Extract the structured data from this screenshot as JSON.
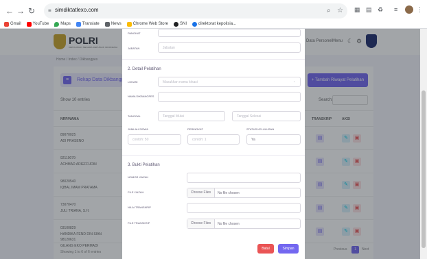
{
  "browser": {
    "url": "simdiktatlexo.com",
    "bookmarks": [
      {
        "label": "Gmail",
        "color": "#ea4335"
      },
      {
        "label": "YouTube",
        "color": "#ff0000"
      },
      {
        "label": "Maps",
        "color": "#34a853"
      },
      {
        "label": "Translate",
        "color": "#4285f4"
      },
      {
        "label": "News",
        "color": "#5f6368"
      },
      {
        "label": "Chrome Web Store",
        "color": "#fbbc04"
      },
      {
        "label": "SNI",
        "color": "#202124"
      },
      {
        "label": "direktorat kepolisia...",
        "color": "#1a73e8"
      }
    ]
  },
  "app": {
    "logo_text": "POLRI",
    "logo_sub": "KEPOLISIAN NEGARA REPUBLIK INDONESIA",
    "nav_left": "Data Personel",
    "nav_right": "Menu"
  },
  "page": {
    "breadcrumb": "Home / Index / Dikbangpes",
    "rekap_button": "Rekap Data Dikbangpes",
    "tambah_button": "+ Tambah Riwayat Pelatihan",
    "show_entries": "Show  10  entries",
    "search_label": "Search:",
    "columns": [
      "NRP/NAMA",
      "TRANSKRIP",
      "AKSI"
    ],
    "rows": [
      {
        "nrp": "89070025",
        "name": "ADI PRASENO"
      },
      {
        "nrp": "92110079",
        "name": "ACHMAD ARIEFFUDIN"
      },
      {
        "nrp": "98020540",
        "name": "IQBAL IMAM PRATAMA"
      },
      {
        "nrp": "73070470",
        "name": "JULI TRIANA, S.H."
      },
      {
        "nrp": "03100829",
        "name": "HANDIKA FEND DIN SIAN"
      },
      {
        "nrp": "98120631",
        "name": "GILANG EKO PERMADI"
      }
    ],
    "showing": "Showing 1 to 6 of 6 entries",
    "pagination": {
      "prev": "Previous",
      "current": "1",
      "next": "Next"
    }
  },
  "modal": {
    "pangkat_label": "PANGKAT",
    "jabatan_label": "JABATAN",
    "jabatan_placeholder": "Jabatan",
    "section2_title": "2. Detail Pelatihan",
    "lokasi_label": "LOKASI",
    "lokasi_placeholder": "Masukkan nama lokasi",
    "nama_label": "NAMA DIKBANGPES",
    "tanggal_label": "TANGGAL",
    "tanggal_mulai_placeholder": "Tanggal Mulai",
    "tanggal_selesai_placeholder": "Tanggal Selesai",
    "jumlah_siswa_label": "JUMLAH SISWA",
    "jumlah_siswa_placeholder": "contoh: 50",
    "peringkat_label": "PERINGKAT",
    "peringkat_placeholder": "contoh: 1",
    "status_label": "STATUS KELULUSAN",
    "status_value": "Ya",
    "section3_title": "3. Bukti Pelatihan",
    "nomor_ijazah_label": "NOMOR IJAZAH",
    "file_ijazah_label": "FILE IJAZAH",
    "nilai_transkrip_label": "NILAI TRANSKRIP",
    "file_transkrip_label": "FILE TRANSKRIP",
    "choose_files": "Choose Files",
    "no_file": "No file chosen",
    "batal": "Batal",
    "simpan": "Simpan"
  }
}
